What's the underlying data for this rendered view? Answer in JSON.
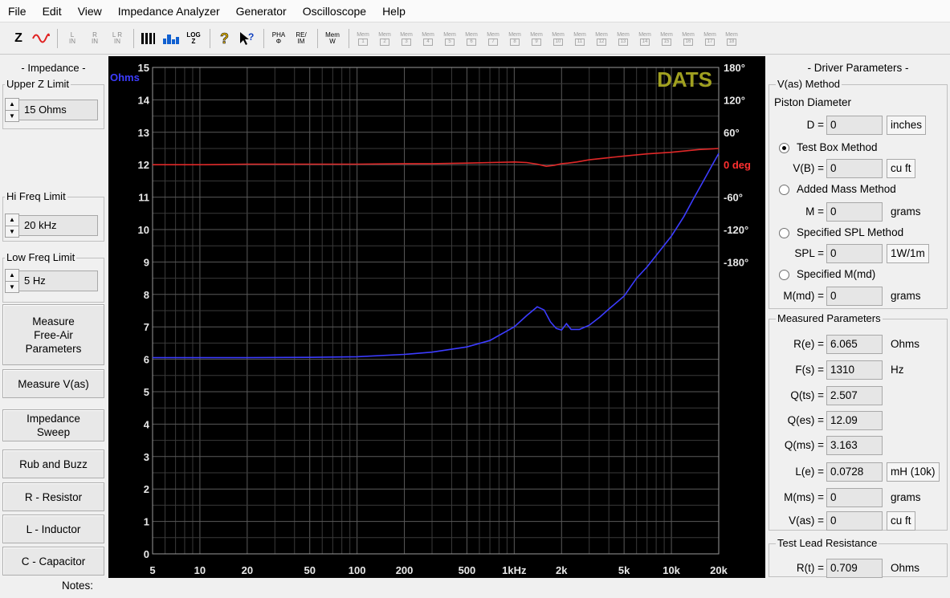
{
  "menu": [
    "File",
    "Edit",
    "View",
    "Impedance Analyzer",
    "Generator",
    "Oscilloscope",
    "Help"
  ],
  "toolbar": {
    "z_label": "Z",
    "l_in": "L\nIN",
    "r_in": "R\nIN",
    "lr_in": "L R\nIN",
    "log_label": "LOG\nZ",
    "pha_label": "PHA\nΦ",
    "reim_label": "RE/\nIM",
    "mem_w_label": "Mem\nW",
    "mem_prefix": "Mem",
    "mem_slots": [
      "1",
      "2",
      "3",
      "4",
      "5",
      "6",
      "7",
      "8",
      "9",
      "10",
      "11",
      "12",
      "13",
      "14",
      "15",
      "16",
      "17",
      "18"
    ]
  },
  "left": {
    "title": "- Impedance -",
    "upper_z": {
      "legend": "Upper Z Limit",
      "value": "15 Ohms"
    },
    "hi_freq": {
      "legend": "Hi Freq Limit",
      "value": "20 kHz"
    },
    "low_freq": {
      "legend": "Low Freq Limit",
      "value": "5 Hz"
    },
    "buttons": {
      "measure_free_air": "Measure\nFree-Air\nParameters",
      "measure_vas": "Measure V(as)",
      "impedance_sweep": "Impedance\nSweep",
      "rub_buzz": "Rub and Buzz",
      "resistor": "R - Resistor",
      "inductor": "L - Inductor",
      "capacitor": "C - Capacitor"
    }
  },
  "chart_data": {
    "type": "line",
    "watermark": "DATS",
    "left_axis_unit": "Ohms",
    "ylim": [
      0,
      15
    ],
    "y_ticks": [
      "0",
      "1",
      "2",
      "3",
      "4",
      "5",
      "6",
      "7",
      "8",
      "9",
      "10",
      "11",
      "12",
      "13",
      "14",
      "15"
    ],
    "y2lim": [
      -180,
      180
    ],
    "y2_ticks": [
      {
        "v": 180,
        "label": "180°"
      },
      {
        "v": 120,
        "label": "120°"
      },
      {
        "v": 60,
        "label": "60°"
      },
      {
        "v": 0,
        "label": "0 deg"
      },
      {
        "v": -60,
        "label": "-60°"
      },
      {
        "v": -120,
        "label": "-120°"
      },
      {
        "v": -180,
        "label": "-180°"
      }
    ],
    "x_scale": "log",
    "xlim": [
      5,
      20000
    ],
    "x_ticks": [
      {
        "v": 5,
        "label": "5"
      },
      {
        "v": 10,
        "label": "10"
      },
      {
        "v": 20,
        "label": "20"
      },
      {
        "v": 50,
        "label": "50"
      },
      {
        "v": 100,
        "label": "100"
      },
      {
        "v": 200,
        "label": "200"
      },
      {
        "v": 500,
        "label": "500"
      },
      {
        "v": 1000,
        "label": "1kHz"
      },
      {
        "v": 2000,
        "label": "2k"
      },
      {
        "v": 5000,
        "label": "5k"
      },
      {
        "v": 10000,
        "label": "10k"
      },
      {
        "v": 20000,
        "label": "20k"
      }
    ],
    "grid": true,
    "series": [
      {
        "axis": "left",
        "color": "#3c3cff",
        "x": [
          5,
          10,
          20,
          50,
          100,
          200,
          300,
          500,
          700,
          1000,
          1200,
          1400,
          1550,
          1700,
          1850,
          2000,
          2150,
          2300,
          2600,
          3000,
          3500,
          4000,
          5000,
          6000,
          7000,
          8000,
          10000,
          12000,
          14000,
          16000,
          18000,
          20000
        ],
        "values": [
          6.05,
          6.05,
          6.05,
          6.06,
          6.08,
          6.15,
          6.22,
          6.38,
          6.58,
          7.0,
          7.35,
          7.62,
          7.52,
          7.15,
          6.95,
          6.9,
          7.1,
          6.92,
          6.92,
          7.05,
          7.3,
          7.55,
          7.95,
          8.5,
          8.85,
          9.2,
          9.8,
          10.4,
          11.0,
          11.5,
          11.95,
          12.35
        ]
      },
      {
        "axis": "right",
        "color": "#e02828",
        "x": [
          5,
          10,
          20,
          50,
          100,
          200,
          300,
          500,
          700,
          1000,
          1200,
          1400,
          1600,
          1800,
          2000,
          2200,
          2500,
          3000,
          4000,
          5000,
          7000,
          10000,
          15000,
          20000
        ],
        "values": [
          0,
          0,
          1,
          1,
          1,
          2,
          2,
          3,
          4,
          5,
          4,
          1,
          -3,
          -1,
          2,
          3,
          5,
          9,
          13,
          16,
          20,
          23,
          28,
          30
        ]
      }
    ]
  },
  "right": {
    "title": "- Driver Parameters -",
    "vas_method": {
      "legend": "V(as) Method",
      "piston_diameter": "Piston Diameter",
      "d_label": "D =",
      "d_value": "0",
      "d_unit": "inches",
      "test_box": "Test Box Method",
      "vb_label": "V(B) =",
      "vb_value": "0",
      "vb_unit": "cu ft",
      "added_mass": "Added Mass Method",
      "m_label": "M =",
      "m_value": "0",
      "m_unit": "grams",
      "spl_method": "Specified SPL Method",
      "spl_label": "SPL =",
      "spl_value": "0",
      "spl_unit": "1W/1m",
      "mmd_method": "Specified M(md)",
      "mmd_label": "M(md) =",
      "mmd_value": "0",
      "mmd_unit": "grams"
    },
    "measured": {
      "legend": "Measured Parameters",
      "re_label": "R(e) =",
      "re_value": "6.065",
      "re_unit": "Ohms",
      "fs_label": "F(s) =",
      "fs_value": "1310",
      "fs_unit": "Hz",
      "qts_label": "Q(ts) =",
      "qts_value": "2.507",
      "qes_label": "Q(es) =",
      "qes_value": "12.09",
      "qms_label": "Q(ms) =",
      "qms_value": "3.163",
      "le_label": "L(e) =",
      "le_value": "0.0728",
      "le_unit": "mH (10k)",
      "mms_label": "M(ms) =",
      "mms_value": "0",
      "mms_unit": "grams",
      "vas_label": "V(as) =",
      "vas_value": "0",
      "vas_unit": "cu ft"
    },
    "lead": {
      "legend": "Test Lead Resistance",
      "rt_label": "R(t) =",
      "rt_value": "0.709",
      "rt_unit": "Ohms"
    }
  },
  "notes_label": "Notes:"
}
